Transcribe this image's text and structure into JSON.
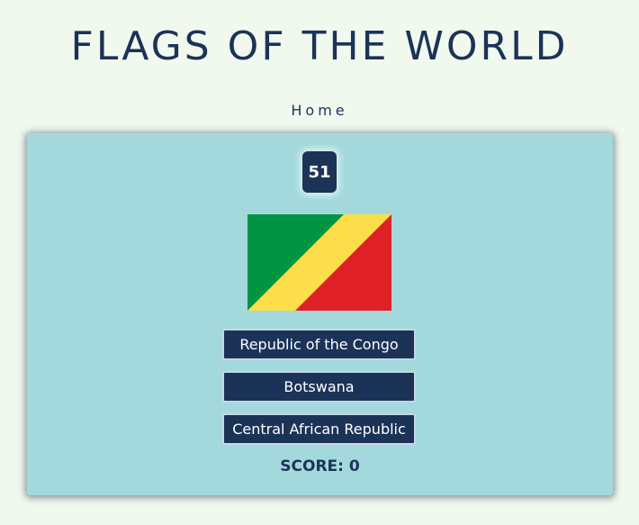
{
  "header": {
    "title": "FLAGS OF THE WORLD",
    "nav_home": "Home"
  },
  "quiz": {
    "counter": "51",
    "flag_icon": "republic-of-the-congo-flag",
    "answers": [
      "Republic of the Congo",
      "Botswana",
      "Central African Republic"
    ],
    "score_label": "SCORE: 0"
  },
  "colors": {
    "background": "#f1f9ef",
    "card": "#a3d9dc",
    "navy": "#1c3358",
    "flag_green": "#009543",
    "flag_yellow": "#fbde4a",
    "flag_red": "#e02027"
  }
}
